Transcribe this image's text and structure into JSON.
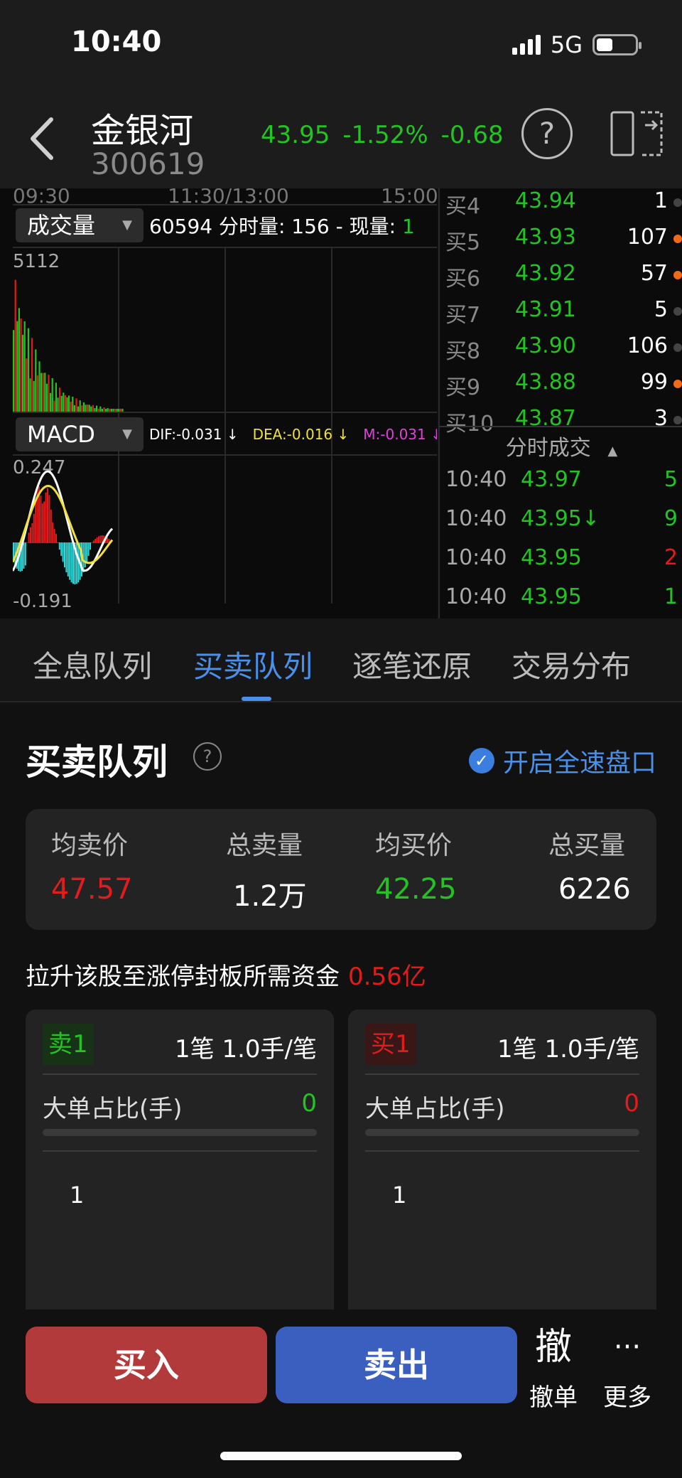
{
  "status": {
    "time": "10:40",
    "network": "5G"
  },
  "header": {
    "name": "金银河",
    "code": "300619",
    "price": "43.95",
    "change_pct": "-1.52%",
    "change": "-0.68",
    "help": "?"
  },
  "chart": {
    "times": [
      "09:30",
      "11:30/13:00",
      "15:00"
    ],
    "volume_label": "成交量",
    "volume_info_prefix": "60594 分时量: 156 - 现量: ",
    "volume_info_now": "1",
    "volume_max": "5112",
    "macd_label": "MACD",
    "dif": "DIF:-0.031 ↓",
    "dea": "DEA:-0.016 ↓",
    "m": "M:-0.031 ↓",
    "macd_max": "0.247",
    "macd_min": "-0.191",
    "colors": {
      "dif": "#ffffff",
      "dea": "#f0e040",
      "m": "#e040e0",
      "up": "#e21c1c",
      "down": "#22c322",
      "macd_neg": "#30d8d8"
    }
  },
  "book": {
    "bids": [
      {
        "level": "买4",
        "price": "43.94",
        "vol": "1",
        "dot": "#444444"
      },
      {
        "level": "买5",
        "price": "43.93",
        "vol": "107",
        "dot": "#f06a1a"
      },
      {
        "level": "买6",
        "price": "43.92",
        "vol": "57",
        "dot": "#f06a1a"
      },
      {
        "level": "买7",
        "price": "43.91",
        "vol": "5",
        "dot": "#444444"
      },
      {
        "level": "买8",
        "price": "43.90",
        "vol": "106",
        "dot": "#444444"
      },
      {
        "level": "买9",
        "price": "43.88",
        "vol": "99",
        "dot": "#f06a1a"
      },
      {
        "level": "买10",
        "price": "43.87",
        "vol": "3",
        "dot": "#444444"
      }
    ],
    "ticks_title": "分时成交",
    "ticks": [
      {
        "time": "10:40",
        "price": "43.97",
        "vol": "5",
        "color": "#22c322"
      },
      {
        "time": "10:40",
        "price": "43.95↓",
        "vol": "9",
        "color": "#22c322"
      },
      {
        "time": "10:40",
        "price": "43.95",
        "vol": "2",
        "color": "#e21c1c"
      },
      {
        "time": "10:40",
        "price": "43.95",
        "vol": "1",
        "color": "#22c322"
      }
    ]
  },
  "tabs": [
    "全息队列",
    "买卖队列",
    "逐笔还原",
    "交易分布"
  ],
  "section": {
    "title": "买卖队列",
    "fast_toggle": "开启全速盘口",
    "summary": {
      "avg_sell_label": "均卖价",
      "avg_sell": "47.57",
      "total_sell_label": "总卖量",
      "total_sell": "1.2万",
      "avg_buy_label": "均买价",
      "avg_buy": "42.25",
      "total_buy_label": "总买量",
      "total_buy": "6226"
    },
    "capital_label": "拉升该股至涨停封板所需资金",
    "capital_value": "0.56亿",
    "sell_queue": {
      "badge": "卖1",
      "count": "1笔   1.0手/笔",
      "big_label": "大单占比(手)",
      "big_value": "0",
      "order": "1"
    },
    "buy_queue": {
      "badge": "买1",
      "count": "1笔   1.0手/笔",
      "big_label": "大单占比(手)",
      "big_value": "0",
      "order": "1"
    }
  },
  "actions": {
    "buy": "买入",
    "sell": "卖出",
    "cancel_icon": "撤",
    "cancel": "撤单",
    "more_icon": "···",
    "more": "更多"
  }
}
